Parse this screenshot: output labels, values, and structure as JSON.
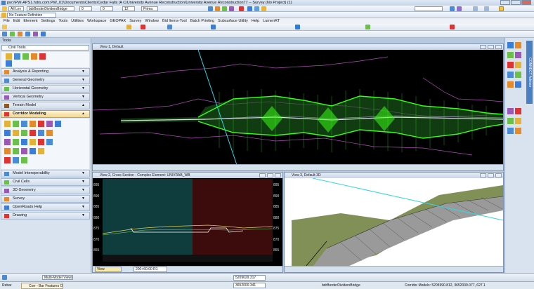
{
  "window": {
    "title": "pw:\\\\PW-APS1.hdrs.com:PW_01\\Documents\\Clients\\Cedar Falls IA C\\University Avenue Reconstruction\\University Avenue Reconstruction77 -- Survey (No Project) (1)"
  },
  "toolbar1": {
    "level_combo": "All Lev",
    "element_combo": "bdrBorderDividersBridge",
    "weight1": "0",
    "weight2": "0",
    "line_weight": "12",
    "style_combo": "Prima"
  },
  "toolbar2": {
    "feature_def": "No Feature Definition"
  },
  "menu": [
    "File",
    "Edit",
    "Element",
    "Settings",
    "Tools",
    "Utilities",
    "Workspace",
    "GEOPAK",
    "Survey",
    "Window",
    "Bid Items-Tool",
    "Batch Printing",
    "Subsurface Utility",
    "Help",
    "LumenRT"
  ],
  "tools_panel": {
    "title": "Tools",
    "workflow": "Civil Tools",
    "sections_top": [
      "Analysis & Reporting",
      "General Geometry",
      "Horizontal Geometry",
      "Vertical Geometry",
      "Terrain Model"
    ],
    "active_section": "Corridor Modeling",
    "sections_bottom": [
      "Model Interoperability",
      "Civil Cells",
      "3D Geometry",
      "Survey",
      "OpenRoads Help",
      "Drawing"
    ]
  },
  "views": {
    "view1": {
      "title": "View 1, Default"
    },
    "view2": {
      "title": "View 2, Cross Section - Complex Element: UNIVRAB_WB",
      "y_labels": [
        "895",
        "890",
        "885",
        "880",
        "875",
        "870",
        "865"
      ],
      "right_labels": [
        "895",
        "890",
        "885",
        "880",
        "875",
        "870",
        "865"
      ],
      "view_properties": "View Properties",
      "station": "200+60.00 R1"
    },
    "view3": {
      "title": "View 3, Default-3D"
    }
  },
  "right_dock": {
    "label": "CONNECT Advisor"
  },
  "status": {
    "model_combo": "Multi-Model Views",
    "coord_x": "5209029.317",
    "coord_y": "3652000.341",
    "element_name": "bdrBorderDividersBridge",
    "message": "Corridor Models: 5205990.812, 3652039.077, 627.1"
  },
  "taskbar": {
    "left_text": "Rebar",
    "tab_text": "Corr - Bar Features Oltion"
  },
  "colors": {
    "chrome": "#d9e3ef",
    "view_bg": "#000000",
    "corridor_green": "#39ff14",
    "alignment_cyan": "#2fd6e6",
    "terrain_magenta": "#b04ab8",
    "xs_left": "#0f3c3c",
    "xs_right": "#3c0c0c"
  }
}
